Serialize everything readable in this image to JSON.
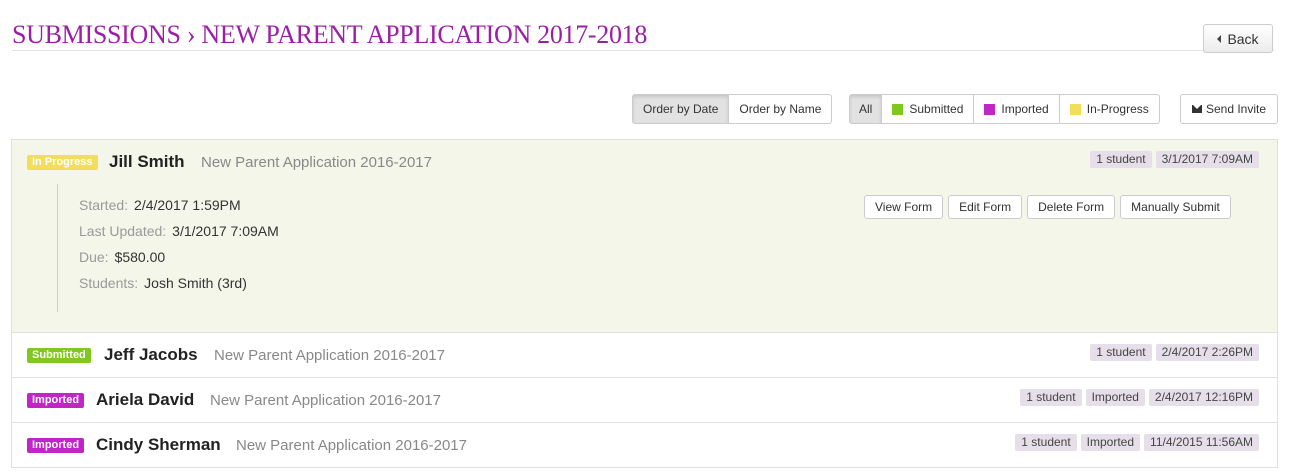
{
  "header": {
    "title": "SUBMISSIONS › NEW PARENT APPLICATION 2017-2018",
    "back_label": "Back"
  },
  "order": {
    "by_date": "Order by Date",
    "by_name": "Order by Name",
    "active": "by_date"
  },
  "filters": {
    "all": "All",
    "submitted": "Submitted",
    "imported": "Imported",
    "in_progress": "In-Progress"
  },
  "colors": {
    "title": "#9b1fa6",
    "submitted": "#7fc91f",
    "imported": "#c125c8",
    "in_progress": "#f2de59",
    "expanded_bg": "#f5f6ea"
  },
  "send_invite_label": "Send Invite",
  "submissions": [
    {
      "status": "In Progress",
      "name": "Jill Smith",
      "application": "New Parent Application 2016-2017",
      "tags": [
        "1 student",
        "3/1/2017 7:09AM"
      ],
      "details": {
        "started_label": "Started:",
        "started": "2/4/2017 1:59PM",
        "updated_label": "Last Updated:",
        "updated": "3/1/2017 7:09AM",
        "due_label": "Due:",
        "due": "$580.00",
        "students_label": "Students:",
        "students": "Josh Smith (3rd)"
      },
      "actions": [
        "View Form",
        "Edit Form",
        "Delete Form",
        "Manually Submit"
      ]
    },
    {
      "status": "Submitted",
      "name": "Jeff Jacobs",
      "application": "New Parent Application 2016-2017",
      "tags": [
        "1 student",
        "2/4/2017 2:26PM"
      ]
    },
    {
      "status": "Imported",
      "name": "Ariela David",
      "application": "New Parent Application 2016-2017",
      "tags": [
        "1 student",
        "Imported",
        "2/4/2017 12:16PM"
      ]
    },
    {
      "status": "Imported",
      "name": "Cindy Sherman",
      "application": "New Parent Application 2016-2017",
      "tags": [
        "1 student",
        "Imported",
        "11/4/2015 11:56AM"
      ]
    }
  ]
}
